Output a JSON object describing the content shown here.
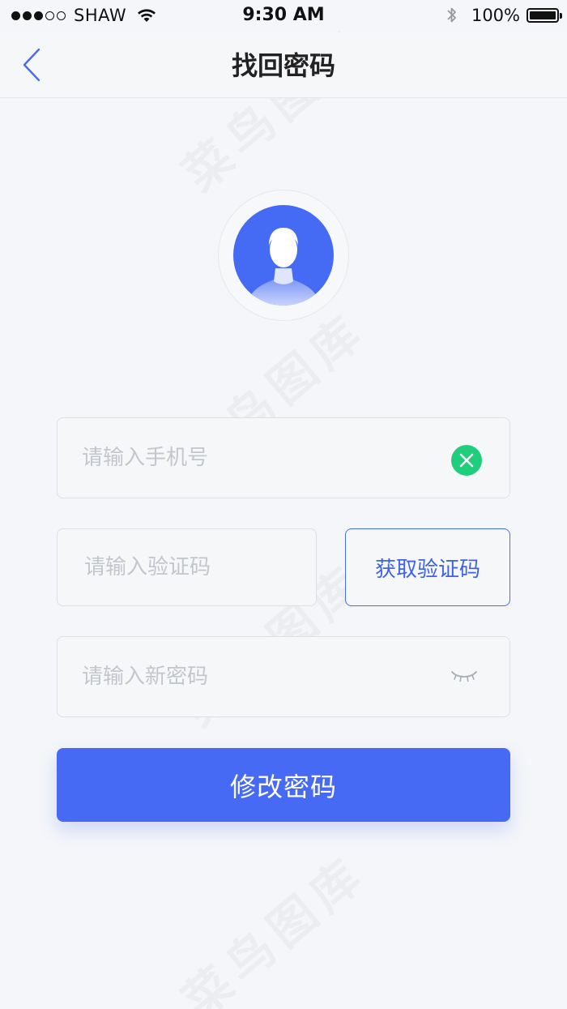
{
  "status_bar": {
    "carrier": "SHAW",
    "signal_bars_filled": 3,
    "signal_bars_total": 5,
    "time": "9:30 AM",
    "battery_percent": "100%",
    "icons": [
      "wifi-icon",
      "bluetooth-icon",
      "battery-icon"
    ]
  },
  "nav": {
    "title": "找回密码",
    "back_icon": "chevron-left-icon"
  },
  "avatar": {
    "icon": "user-silhouette-icon"
  },
  "form": {
    "phone": {
      "value": "",
      "placeholder": "请输入手机号",
      "clear_icon": "clear-x-icon"
    },
    "code": {
      "value": "",
      "placeholder": "请输入验证码"
    },
    "get_code_label": "获取验证码",
    "password": {
      "value": "",
      "placeholder": "请输入新密码",
      "toggle_icon": "eye-closed-icon"
    },
    "submit_label": "修改密码"
  },
  "watermark": "菜鸟图库",
  "colors": {
    "accent": "#476af4",
    "success": "#1fce7a",
    "background": "#f4f6f9"
  }
}
